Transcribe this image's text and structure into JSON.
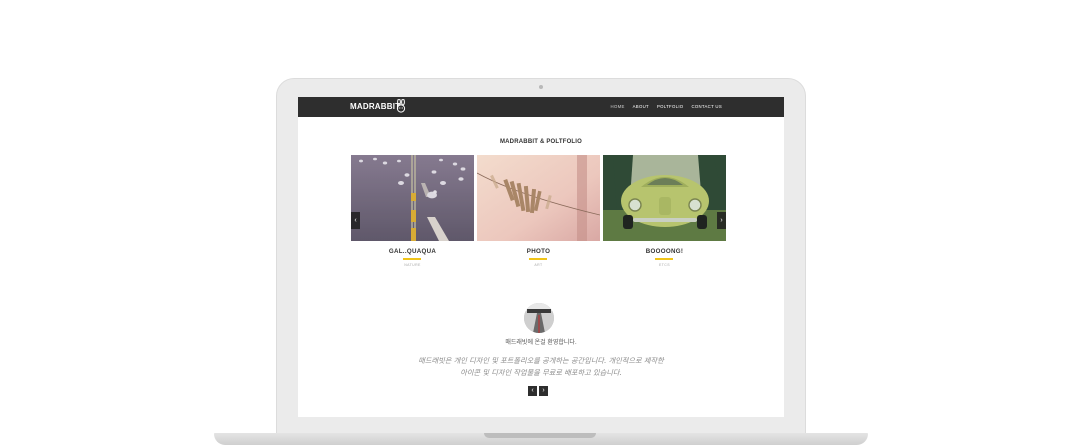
{
  "site": {
    "logo": "MADRABBIT",
    "menu": [
      {
        "label": "HOME",
        "active": true
      },
      {
        "label": "ABOUT",
        "active": false
      },
      {
        "label": "POLTFOLIO",
        "active": false
      },
      {
        "label": "CONTACT US",
        "active": false
      }
    ]
  },
  "portfolio": {
    "title": "MADRABBIT & POLTFOLIO",
    "prev_icon": "‹",
    "next_icon": "›",
    "items": [
      {
        "title": "GAL..QUAQUA",
        "category": "NATURE",
        "image": "seagulls-on-road"
      },
      {
        "title": "PHOTO",
        "category": "ART",
        "image": "clothespins"
      },
      {
        "title": "BOOOONG!",
        "category": "ETCS",
        "image": "green-beetle-car"
      }
    ]
  },
  "testimonial": {
    "welcome": "매드래빗에 온걸 환영합니다.",
    "quote_line1": "매드래빗은 개인 디자인 및 포트폴리오를 공개하는 공간입니다. 개인적으로 제작한",
    "quote_line2": "아이콘 및 디자인 작업물을 무료로 배포하고 있습니다.",
    "prev_icon": "‹",
    "next_icon": "›"
  },
  "colors": {
    "navbar": "#2e2e2e",
    "accent": "#f0c419",
    "background": "#ffffff"
  }
}
